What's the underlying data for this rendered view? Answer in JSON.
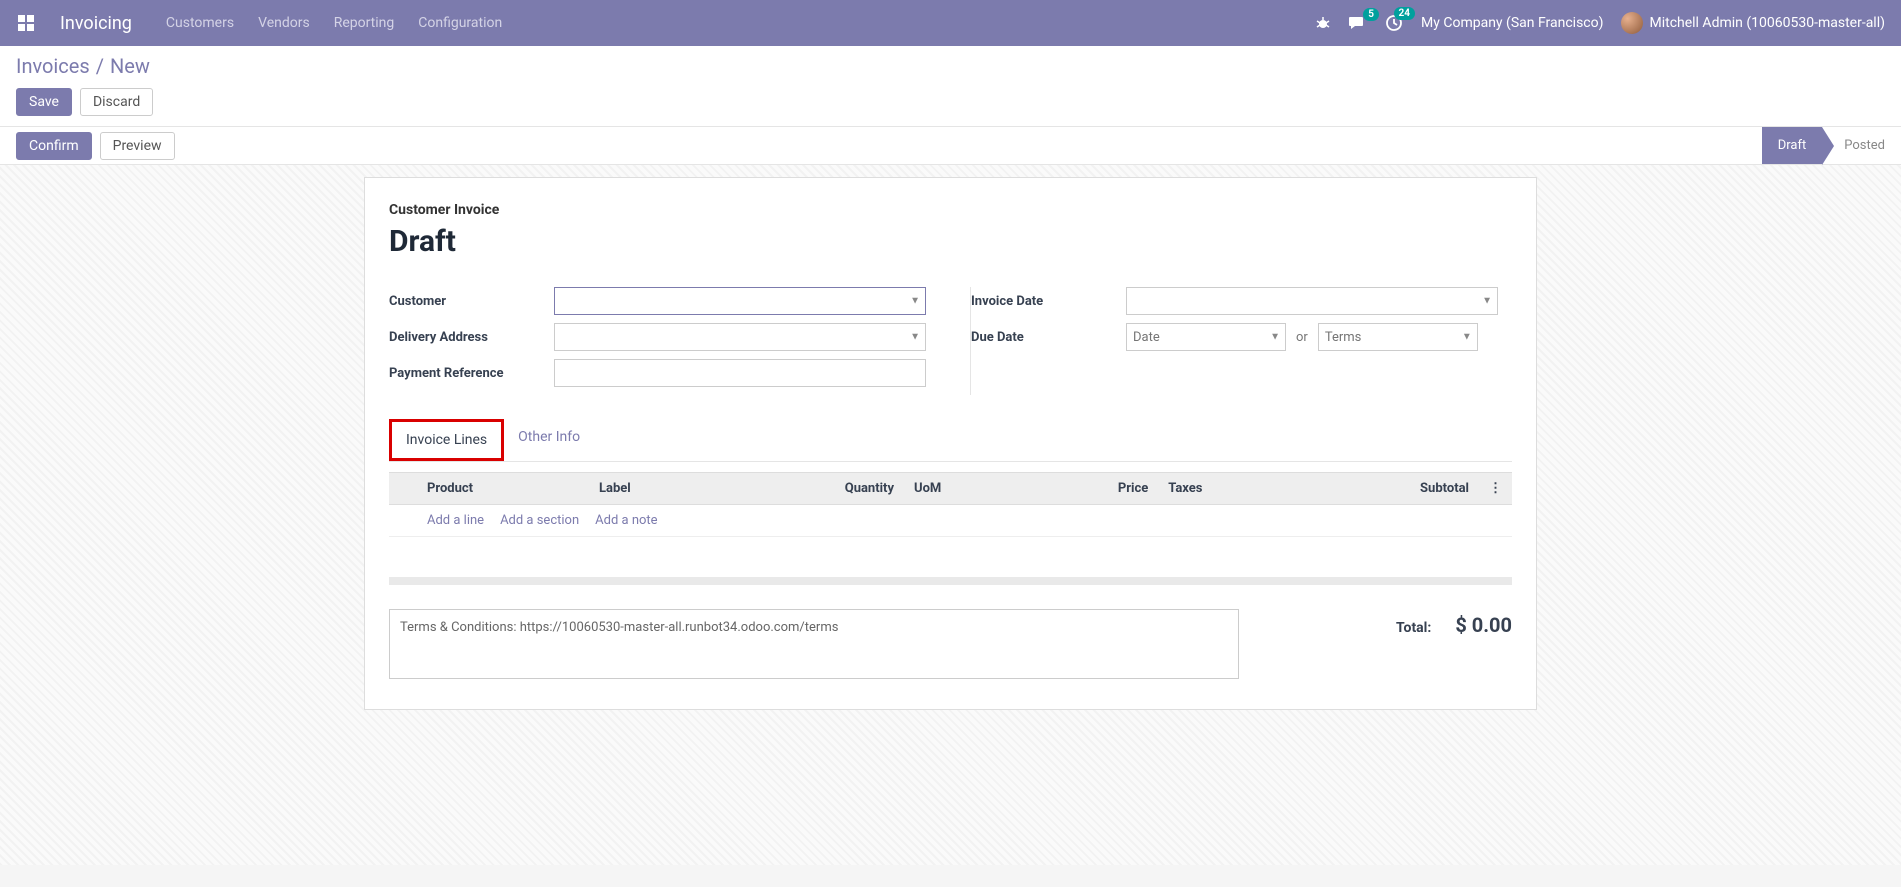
{
  "navbar": {
    "app_name": "Invoicing",
    "menus": [
      "Customers",
      "Vendors",
      "Reporting",
      "Configuration"
    ],
    "messages_badge": "5",
    "activities_badge": "24",
    "company": "My Company (San Francisco)",
    "user": "Mitchell Admin (10060530-master-all)"
  },
  "breadcrumb": {
    "root": "Invoices",
    "current": "New"
  },
  "buttons": {
    "save": "Save",
    "discard": "Discard",
    "confirm": "Confirm",
    "preview": "Preview"
  },
  "status": {
    "draft": "Draft",
    "posted": "Posted"
  },
  "form": {
    "type_label": "Customer Invoice",
    "title": "Draft",
    "labels": {
      "customer": "Customer",
      "delivery_address": "Delivery Address",
      "payment_reference": "Payment Reference",
      "invoice_date": "Invoice Date",
      "due_date": "Due Date"
    },
    "due_date_placeholder": "Date",
    "terms_placeholder": "Terms",
    "or": "or"
  },
  "tabs": {
    "invoice_lines": "Invoice Lines",
    "other_info": "Other Info"
  },
  "table": {
    "headers": {
      "product": "Product",
      "label": "Label",
      "quantity": "Quantity",
      "uom": "UoM",
      "price": "Price",
      "taxes": "Taxes",
      "subtotal": "Subtotal"
    },
    "add_line": "Add a line",
    "add_section": "Add a section",
    "add_note": "Add a note"
  },
  "terms": "Terms & Conditions: https://10060530-master-all.runbot34.odoo.com/terms",
  "totals": {
    "total_label": "Total:",
    "total_value": "$ 0.00"
  }
}
